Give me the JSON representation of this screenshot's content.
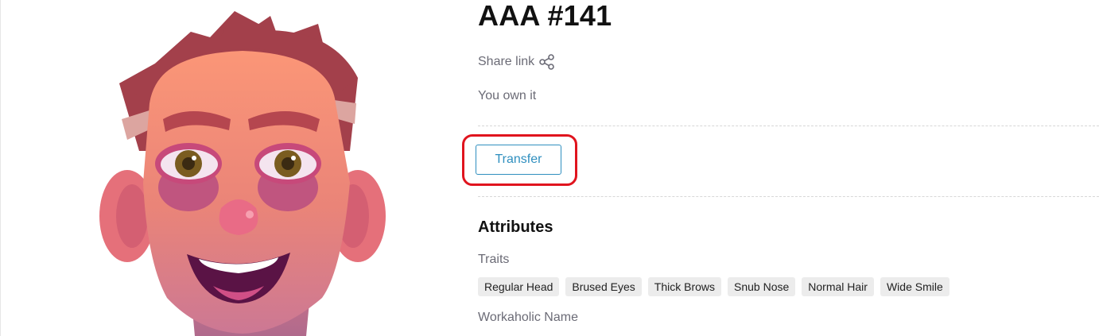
{
  "nft": {
    "title": "AAA #141",
    "share_label": "Share link",
    "ownership": "You own it",
    "transfer_label": "Transfer"
  },
  "attributes": {
    "heading": "Attributes",
    "traits_label": "Traits",
    "traits": [
      "Regular Head",
      "Brused Eyes",
      "Thick Brows",
      "Snub Nose",
      "Normal Hair",
      "Wide Smile"
    ],
    "workaholic_label": "Workaholic Name"
  },
  "icons": {
    "share": "share-icon"
  },
  "colors": {
    "accent": "#2f8fbf",
    "highlight": "#e0141e",
    "muted_text": "#6b6b76",
    "chip_bg": "#ececec"
  }
}
